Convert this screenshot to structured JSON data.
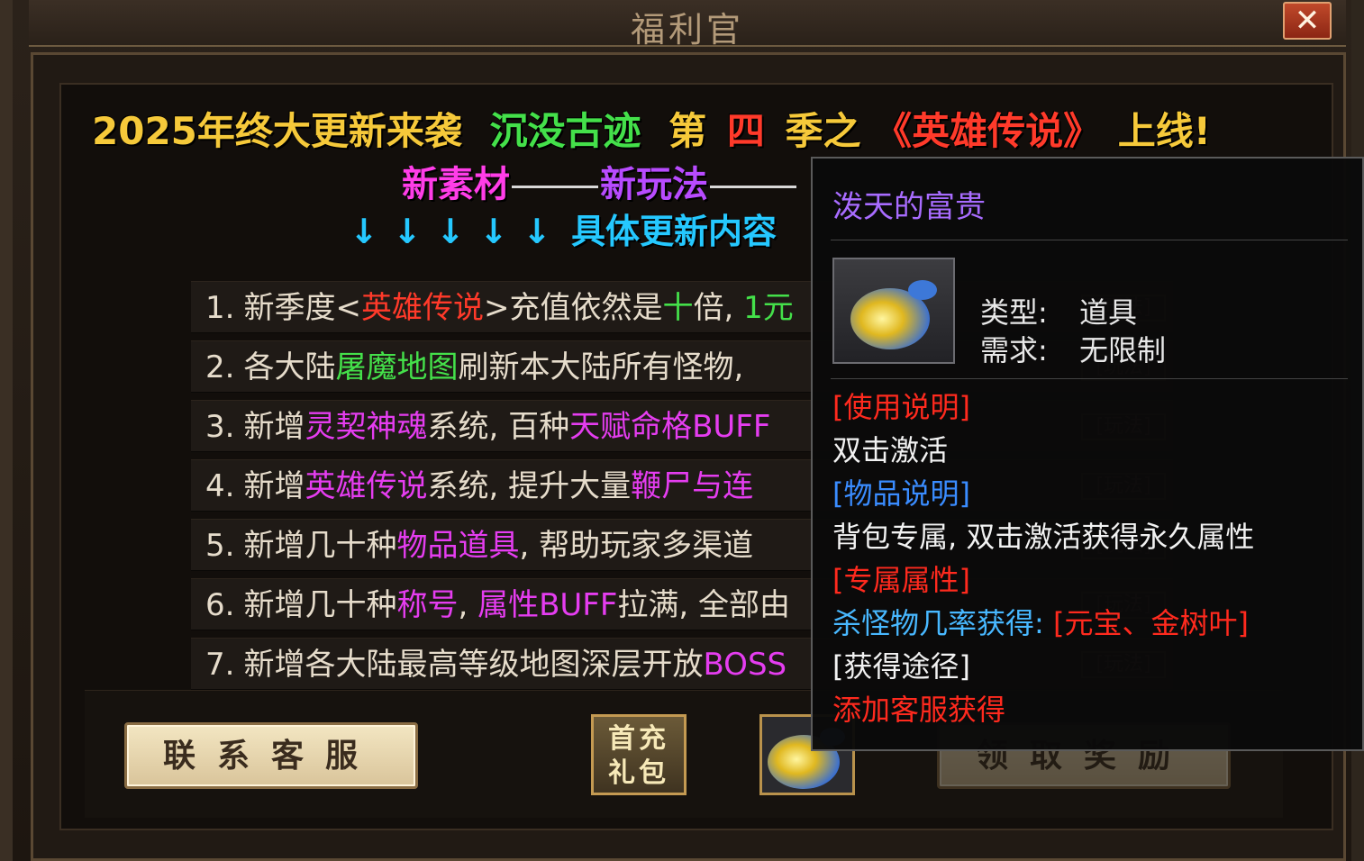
{
  "window": {
    "title": "福利官",
    "close_label": "✕"
  },
  "headline": {
    "part1": "2025年终大更新来袭",
    "part2": "沉没古迹",
    "part3a": "第",
    "part3b": "四",
    "part3c": "季之",
    "part4": "《英雄传说》",
    "part5": "上线!"
  },
  "subheadline": {
    "a": "新素材",
    "b": "新玩法"
  },
  "details_label": "具体更新内容",
  "arrow_glyph": "↓",
  "update_rows": [
    {
      "n": "1.",
      "segs": [
        [
          "新季度<",
          "w"
        ],
        [
          "英雄传说",
          "r"
        ],
        [
          ">充值依然是",
          "w"
        ],
        [
          "十",
          "g"
        ],
        [
          "倍, ",
          "w"
        ],
        [
          "1元",
          "g"
        ]
      ]
    },
    {
      "n": "2.",
      "segs": [
        [
          "各大陆",
          "w"
        ],
        [
          "屠魔地图",
          "g"
        ],
        [
          "刷新本大陆所有怪物, ",
          "w"
        ]
      ]
    },
    {
      "n": "3.",
      "segs": [
        [
          "新增",
          "w"
        ],
        [
          "灵契神魂",
          "m"
        ],
        [
          "系统, 百种",
          "w"
        ],
        [
          "天赋命格BUFF",
          "m"
        ]
      ]
    },
    {
      "n": "4.",
      "segs": [
        [
          "新增",
          "w"
        ],
        [
          "英雄传说",
          "m"
        ],
        [
          "系统, 提升大量",
          "w"
        ],
        [
          "鞭尸与连",
          "m"
        ]
      ]
    },
    {
      "n": "5.",
      "segs": [
        [
          "新增几十种",
          "w"
        ],
        [
          "物品道具",
          "m"
        ],
        [
          ", 帮助玩家多渠道",
          "w"
        ]
      ]
    },
    {
      "n": "6.",
      "segs": [
        [
          "新增几十种",
          "w"
        ],
        [
          "称号",
          "m"
        ],
        [
          ", ",
          "w"
        ],
        [
          "属性BUFF",
          "m"
        ],
        [
          "拉满, 全部由",
          "w"
        ]
      ]
    },
    {
      "n": "7.",
      "segs": [
        [
          "新增各大陆最高等级地图深层开放",
          "w"
        ],
        [
          "BOSS",
          "m"
        ]
      ]
    }
  ],
  "row_tag": "[玩法]",
  "buttons": {
    "contact_service": "联系客服",
    "first_recharge_line1": "首充",
    "first_recharge_line2": "礼包",
    "claim_reward": "领取奖励"
  },
  "tooltip": {
    "item_name": "泼天的富贵",
    "type_key": "类型:",
    "type_val": "道具",
    "req_key": "需求:",
    "req_val": "无限制",
    "use_header": "[使用说明]",
    "use_text": "双击激活",
    "item_header": "[物品说明]",
    "item_text": "背包专属, 双击激活获得永久属性",
    "attr_header": "[专属属性]",
    "attr_text": "杀怪物几率获得:",
    "attr_value": "[元宝、金树叶]",
    "source_header": "[获得途径]",
    "source_text": "添加客服获得"
  },
  "colors": {
    "headline_yellow": "#f6c93a",
    "accent_green": "#44e04a",
    "accent_red": "#ff3a2a",
    "accent_magenta": "#ff3de8",
    "accent_cyan": "#25c8ff",
    "tooltip_name_purple": "#a86cff"
  }
}
